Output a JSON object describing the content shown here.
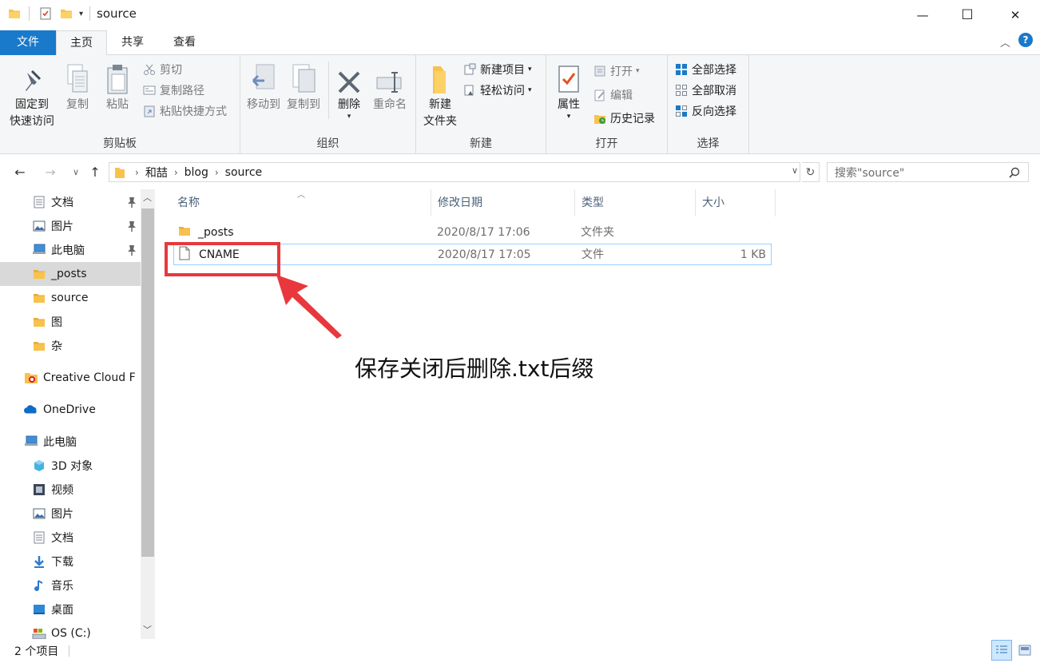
{
  "window": {
    "title": "source",
    "minimize": "—",
    "maximize": "☐",
    "close": "✕"
  },
  "tabs": {
    "file": "文件",
    "home": "主页",
    "share": "共享",
    "view": "查看"
  },
  "ribbon": {
    "clipboard": {
      "label": "剪贴板",
      "pin_line1": "固定到",
      "pin_line2": "快速访问",
      "copy": "复制",
      "paste": "粘贴",
      "cut": "剪切",
      "copy_path": "复制路径",
      "paste_shortcut": "粘贴快捷方式"
    },
    "organize": {
      "label": "组织",
      "move_to": "移动到",
      "copy_to": "复制到",
      "delete": "删除",
      "rename": "重命名"
    },
    "new": {
      "label": "新建",
      "new_folder_line1": "新建",
      "new_folder_line2": "文件夹",
      "new_item": "新建项目",
      "easy_access": "轻松访问"
    },
    "open": {
      "label": "打开",
      "properties": "属性",
      "open": "打开",
      "edit": "编辑",
      "history": "历史记录"
    },
    "select": {
      "label": "选择",
      "select_all": "全部选择",
      "select_none": "全部取消",
      "invert": "反向选择"
    }
  },
  "address": {
    "crumbs": [
      "和喆",
      "blog",
      "source"
    ],
    "search_placeholder": "搜索\"source\""
  },
  "sidebar": {
    "items": [
      {
        "label": "文档",
        "icon": "document-icon",
        "pinned": true
      },
      {
        "label": "图片",
        "icon": "picture-icon",
        "pinned": true
      },
      {
        "label": "此电脑",
        "icon": "computer-icon",
        "pinned": true
      },
      {
        "label": "_posts",
        "icon": "folder-icon",
        "selected": true
      },
      {
        "label": "source",
        "icon": "folder-icon"
      },
      {
        "label": "图",
        "icon": "folder-icon"
      },
      {
        "label": "杂",
        "icon": "folder-icon"
      },
      {
        "label": "Creative Cloud F",
        "icon": "creative-cloud-icon"
      },
      {
        "label": "OneDrive",
        "icon": "onedrive-icon"
      },
      {
        "label": "此电脑",
        "icon": "computer-icon"
      },
      {
        "label": "3D 对象",
        "icon": "3d-objects-icon"
      },
      {
        "label": "视频",
        "icon": "video-icon"
      },
      {
        "label": "图片",
        "icon": "picture-icon"
      },
      {
        "label": "文档",
        "icon": "document-icon"
      },
      {
        "label": "下载",
        "icon": "download-icon"
      },
      {
        "label": "音乐",
        "icon": "music-icon"
      },
      {
        "label": "桌面",
        "icon": "desktop-icon"
      },
      {
        "label": "OS (C:)",
        "icon": "drive-icon"
      }
    ]
  },
  "filelist": {
    "columns": {
      "name": "名称",
      "date": "修改日期",
      "type": "类型",
      "size": "大小"
    },
    "rows": [
      {
        "name": "_posts",
        "date": "2020/8/17 17:06",
        "type": "文件夹",
        "size": "",
        "icon": "folder-icon"
      },
      {
        "name": "CNAME",
        "date": "2020/8/17 17:05",
        "type": "文件",
        "size": "1 KB",
        "icon": "file-icon"
      }
    ]
  },
  "status": {
    "count": "2 个项目"
  },
  "annotation": {
    "text": "保存关闭后删除.txt后缀",
    "color": "#e8383d"
  },
  "colors": {
    "accent": "#1979ca",
    "folder": "#f8c24d",
    "selection": "#99d1ff"
  }
}
